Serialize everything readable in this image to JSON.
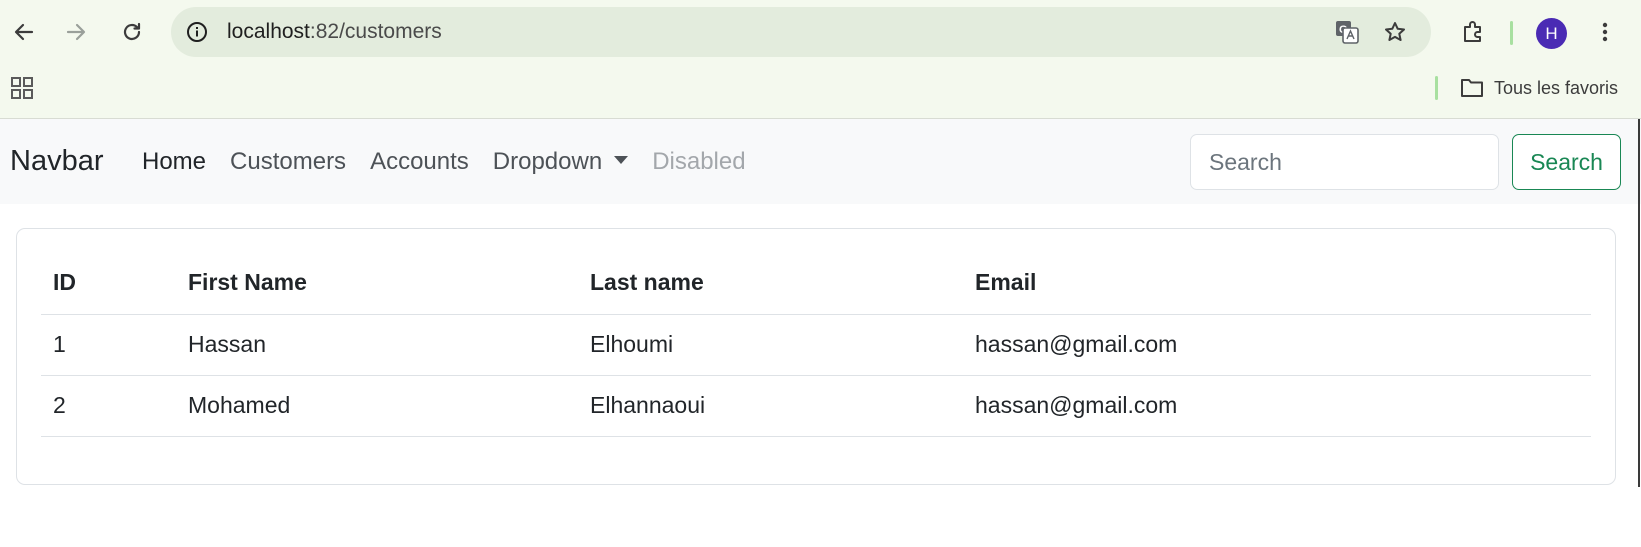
{
  "browser": {
    "url_host": "localhost",
    "url_path": ":82/customers",
    "avatar_letter": "H",
    "bookmarks_label": "Tous les favoris",
    "icons": [
      "back-icon",
      "forward-icon",
      "reload-icon",
      "site-info-icon",
      "translate-icon",
      "star-icon",
      "extensions-icon",
      "menu-icon",
      "apps-grid-icon",
      "folder-icon"
    ]
  },
  "navbar": {
    "brand": "Navbar",
    "links": [
      {
        "label": "Home",
        "state": "active"
      },
      {
        "label": "Customers",
        "state": "normal"
      },
      {
        "label": "Accounts",
        "state": "normal"
      },
      {
        "label": "Dropdown",
        "state": "dropdown"
      },
      {
        "label": "Disabled",
        "state": "disabled"
      }
    ],
    "search_placeholder": "Search",
    "search_button": "Search"
  },
  "table": {
    "headers": [
      "ID",
      "First Name",
      "Last name",
      "Email"
    ],
    "rows": [
      [
        "1",
        "Hassan",
        "Elhoumi",
        "hassan@gmail.com"
      ],
      [
        "2",
        "Mohamed",
        "Elhannaoui",
        "hassan@gmail.com"
      ]
    ]
  },
  "colors": {
    "chrome_bg": "#f4f9ee",
    "omnibox_bg": "#e3ecdd",
    "avatar": "#4a2bb4",
    "success": "#198754",
    "navbar_bg": "#f8f9fa"
  }
}
